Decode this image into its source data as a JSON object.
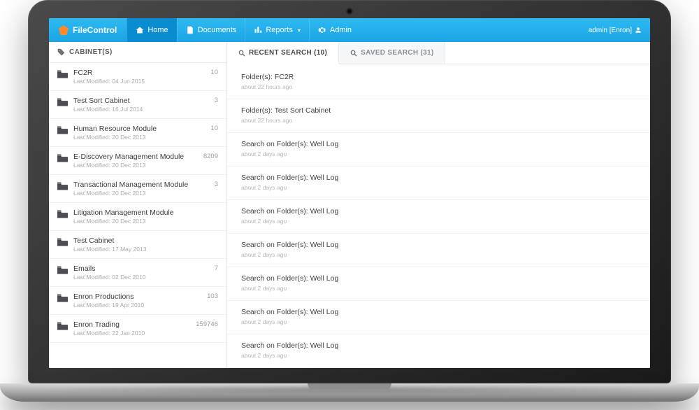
{
  "brand": {
    "name": "FileControl"
  },
  "nav": {
    "home": "Home",
    "documents": "Documents",
    "reports": "Reports",
    "admin": "Admin"
  },
  "user": {
    "label": "admin [Enron]"
  },
  "sidebar": {
    "heading": "CABINET(S)",
    "items": [
      {
        "name": "FC2R",
        "meta": "Last Modified: 04 Jun 2015",
        "count": "10"
      },
      {
        "name": "Test Sort Cabinet",
        "meta": "Last Modified: 16 Jul 2014",
        "count": "3"
      },
      {
        "name": "Human Resource Module",
        "meta": "Last Modified: 20 Dec 2013",
        "count": "10"
      },
      {
        "name": "E-Discovery Management Module",
        "meta": "Last Modified: 20 Dec 2013",
        "count": "8209"
      },
      {
        "name": "Transactional Management Module",
        "meta": "Last Modified: 20 Dec 2013",
        "count": "3"
      },
      {
        "name": "Litigation Management Module",
        "meta": "Last Modified: 20 Dec 2013",
        "count": ""
      },
      {
        "name": "Test Cabinet",
        "meta": "Last Modified: 17 May 2013",
        "count": ""
      },
      {
        "name": "Emails",
        "meta": "Last Modified: 02 Dec 2010",
        "count": "7"
      },
      {
        "name": "Enron Productions",
        "meta": "Last Modified: 19 Apr 2010",
        "count": "103"
      },
      {
        "name": "Enron Trading",
        "meta": "Last Modified: 22 Jan 2010",
        "count": "159746"
      }
    ]
  },
  "tabs": {
    "recent": "RECENT SEARCH (10)",
    "saved": "SAVED SEARCH (31)"
  },
  "recent": [
    {
      "title": "Folder(s): FC2R",
      "time": "about 22 hours ago"
    },
    {
      "title": "Folder(s): Test Sort Cabinet",
      "time": "about 22 hours ago"
    },
    {
      "title": "Search on Folder(s): Well Log",
      "time": "about 2 days ago"
    },
    {
      "title": "Search on Folder(s): Well Log",
      "time": "about 2 days ago"
    },
    {
      "title": "Search on Folder(s): Well Log",
      "time": "about 2 days ago"
    },
    {
      "title": "Search on Folder(s): Well Log",
      "time": "about 2 days ago"
    },
    {
      "title": "Search on Folder(s): Well Log",
      "time": "about 2 days ago"
    },
    {
      "title": "Search on Folder(s): Well Log",
      "time": "about 2 days ago"
    },
    {
      "title": "Search on Folder(s): Well Log",
      "time": "about 2 days ago"
    }
  ]
}
